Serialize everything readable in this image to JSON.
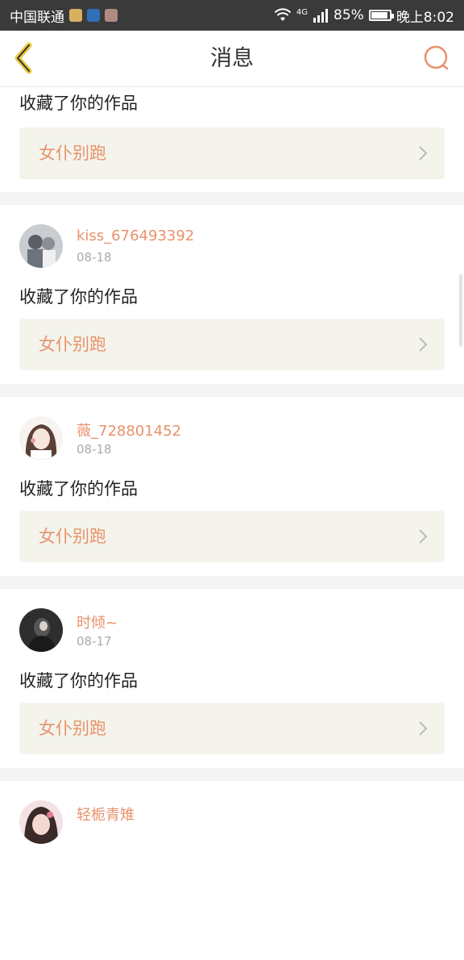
{
  "status_bar": {
    "carrier": "中国联通",
    "network": "4G",
    "battery": "85%",
    "battery_level": 0.85,
    "time": "晚上8:02"
  },
  "header": {
    "title": "消息",
    "back_icon": "chevron-left-icon",
    "search_icon": "search-icon",
    "accent_color": "#e8926a"
  },
  "messages": [
    {
      "action": "收藏了你的作品",
      "work": "女仆别跑"
    },
    {
      "username": "kiss_676493392",
      "date": "08-18",
      "action": "收藏了你的作品",
      "work": "女仆别跑"
    },
    {
      "username": "薇_728801452",
      "date": "08-18",
      "action": "收藏了你的作品",
      "work": "女仆别跑"
    },
    {
      "username": "时倾~",
      "date": "08-17",
      "action": "收藏了你的作品",
      "work": "女仆别跑"
    },
    {
      "username": "轻栀青雉"
    }
  ]
}
